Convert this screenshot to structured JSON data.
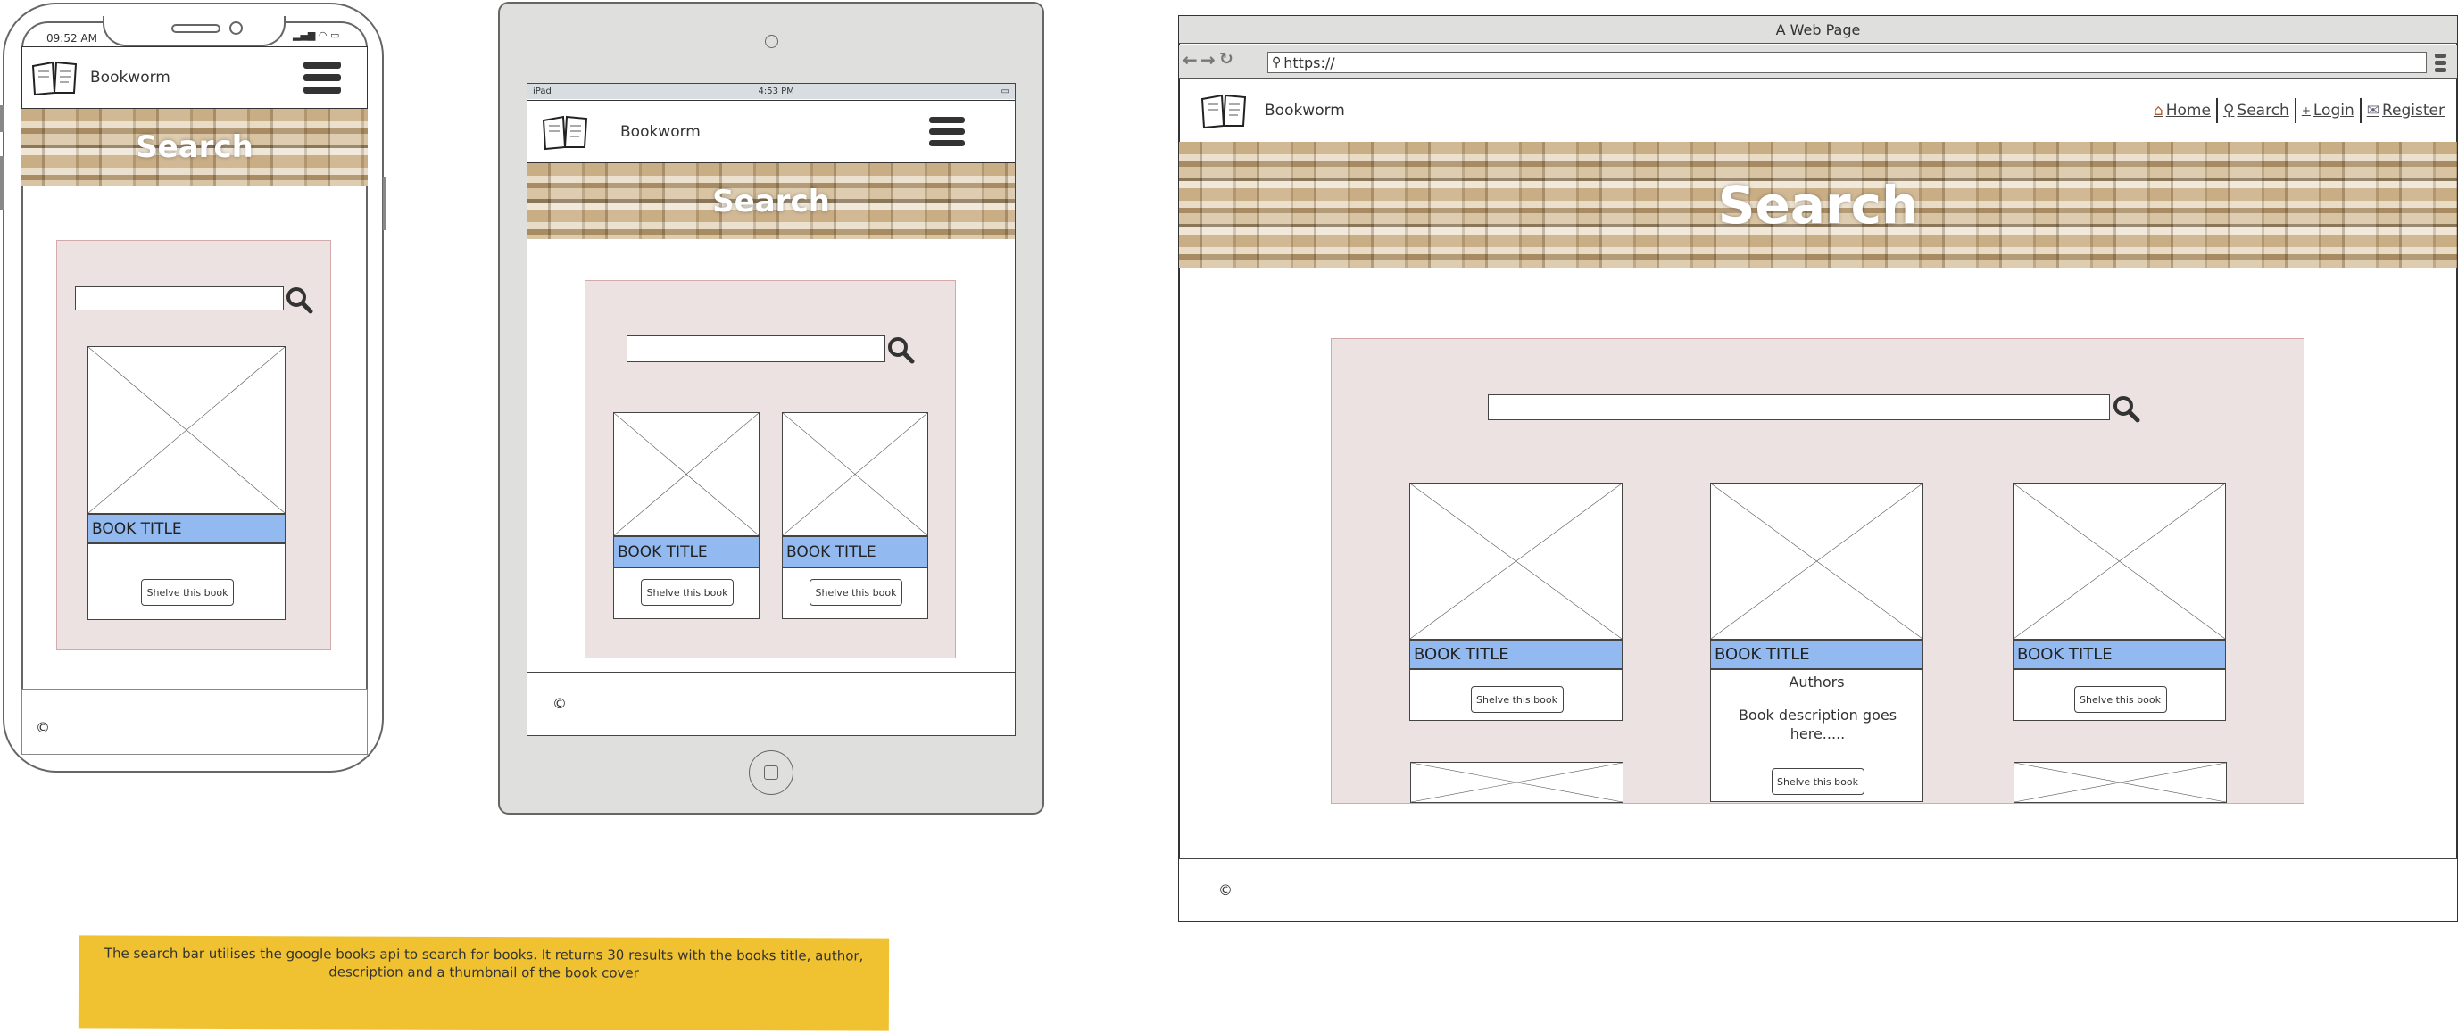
{
  "phone": {
    "status_time": "09:52 AM",
    "brand": "Bookworm",
    "banner_title": "Search",
    "search_placeholder": "",
    "cards": [
      {
        "title": "BOOK TITLE",
        "button": "Shelve this book"
      }
    ],
    "footer_text": "©"
  },
  "tablet": {
    "status_device": "iPad",
    "status_time": "4:53 PM",
    "brand": "Bookworm",
    "banner_title": "Search",
    "search_placeholder": "",
    "cards": [
      {
        "title": "BOOK TITLE",
        "button": "Shelve this book"
      },
      {
        "title": "BOOK TITLE",
        "button": "Shelve this book"
      }
    ],
    "footer_text": "©"
  },
  "desktop": {
    "window_title": "A Web Page",
    "url": "https://",
    "brand": "Bookworm",
    "nav": [
      {
        "label": "Home",
        "icon": "home-icon"
      },
      {
        "label": "Search",
        "icon": "search-icon"
      },
      {
        "label": "Login",
        "icon": "plus-icon"
      },
      {
        "label": "Register",
        "icon": "register-icon"
      }
    ],
    "banner_title": "Search",
    "search_placeholder": "",
    "cards": [
      {
        "title": "BOOK TITLE",
        "button": "Shelve this book"
      },
      {
        "title": "BOOK TITLE",
        "authors": "Authors",
        "description": "Book description goes here.....",
        "button": "Shelve this book"
      },
      {
        "title": "BOOK TITLE",
        "button": "Shelve this book"
      }
    ],
    "footer_text": "©"
  },
  "note": {
    "text": "The search bar utilises the google books api to search for books. It returns 30 results with the books title, author, description and a thumbnail of the book cover",
    "color": "#f0c231"
  },
  "colors": {
    "title_bar": "#92b9f0",
    "panel": "#ede2e2",
    "device_gray": "#dfdfdd"
  }
}
